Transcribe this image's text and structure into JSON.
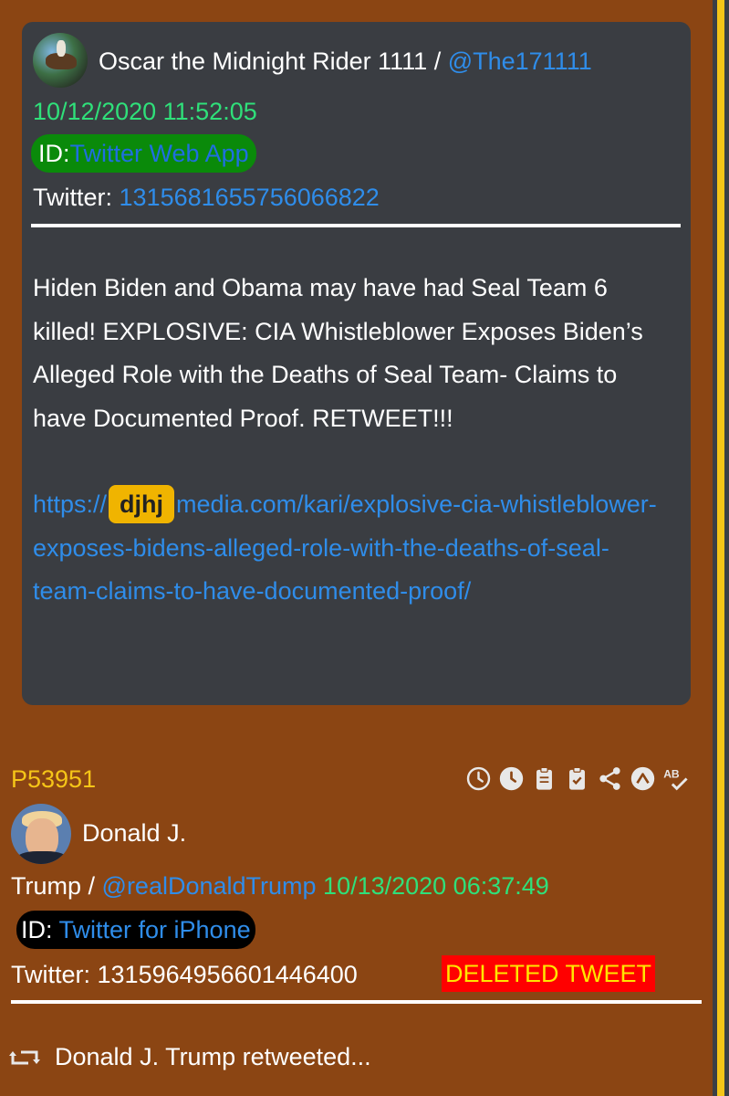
{
  "quoted": {
    "author": "Oscar the Midnight Rider 1111",
    "separator": " / ",
    "handle": "@The171111",
    "timestamp": "10/12/2020 11:52:05",
    "client_label": "ID:",
    "client_value": "Twitter Web App",
    "twitter_label": "Twitter: ",
    "twitter_id": "1315681655756066822",
    "body": "Hiden Biden and Obama may have had Seal Team 6 killed! EXPLOSIVE: CIA Whistleblower Exposes Biden’s Alleged Role with the Deaths of Seal Team- Claims to have Documented Proof. RETWEET!!!",
    "link_prefix": "https://",
    "link_redaction": "djhj",
    "link_suffix": "media.com/kari/explosive-cia-whistleblower-exposes-bidens-alleged-role-with-the-deaths-of-seal-team-claims-to-have-documented-proof/"
  },
  "post": {
    "id": "P53951",
    "author_line1": "Donald J.",
    "author_line2": "Trump",
    "separator": " / ",
    "handle": "@realDonaldTrump",
    "timestamp": "10/13/2020 06:37:49",
    "client_label": "ID: ",
    "client_value": "Twitter for iPhone",
    "twitter_label": "Twitter: ",
    "twitter_id": "1315964956601446400",
    "status": "DELETED TWEET",
    "retweet_text": "Donald J. Trump  retweeted..."
  },
  "toolbar": {
    "icons": [
      "clock-outline-icon",
      "clock-filled-icon",
      "clipboard-icon",
      "clipboard-check-icon",
      "share-icon",
      "up-arrow-circle-icon",
      "spellcheck-icon"
    ]
  },
  "colors": {
    "background": "#8b4513",
    "card": "#3a3d42",
    "link": "#2f8dea",
    "date": "#2fe07a",
    "post_id": "#f5c518",
    "deleted_bg": "#ff0000",
    "deleted_text": "#ffe600"
  }
}
